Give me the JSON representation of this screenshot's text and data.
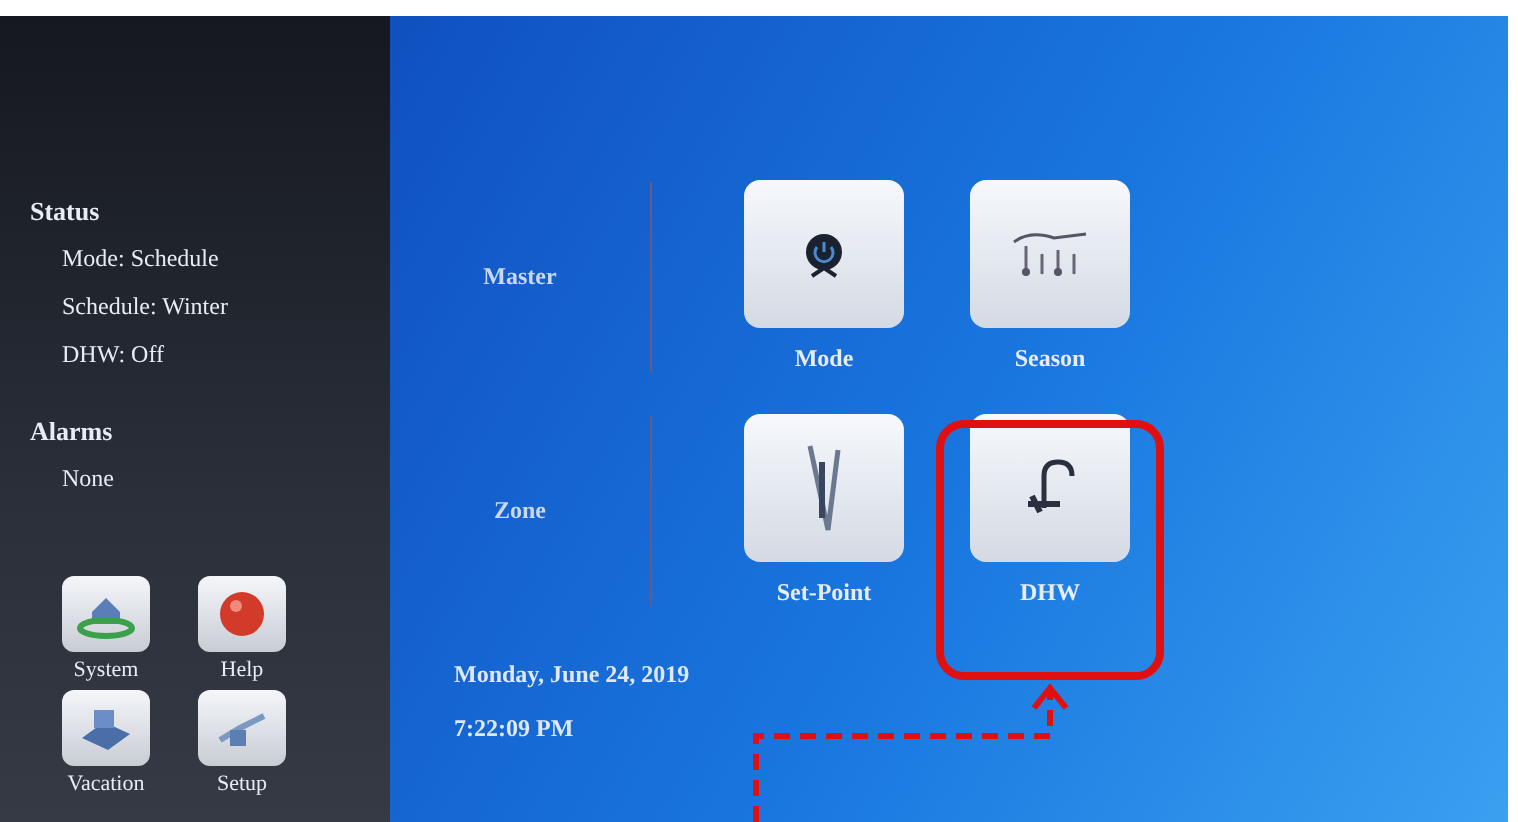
{
  "status": {
    "heading": "Status",
    "items": [
      "Mode: Schedule",
      "Schedule: Winter",
      "DHW: Off"
    ]
  },
  "alarms": {
    "heading": "Alarms",
    "items": [
      "None"
    ]
  },
  "shortcuts": [
    {
      "label": "System"
    },
    {
      "label": "Help"
    },
    {
      "label": "Vacation"
    },
    {
      "label": "Setup"
    }
  ],
  "groups": [
    {
      "label": "Master",
      "tiles": [
        {
          "label": "Mode"
        },
        {
          "label": "Season"
        }
      ]
    },
    {
      "label": "Zone",
      "tiles": [
        {
          "label": "Set-Point"
        },
        {
          "label": "DHW"
        }
      ]
    }
  ],
  "date": "Monday, June 24, 2019",
  "time": "7:22:09 PM"
}
